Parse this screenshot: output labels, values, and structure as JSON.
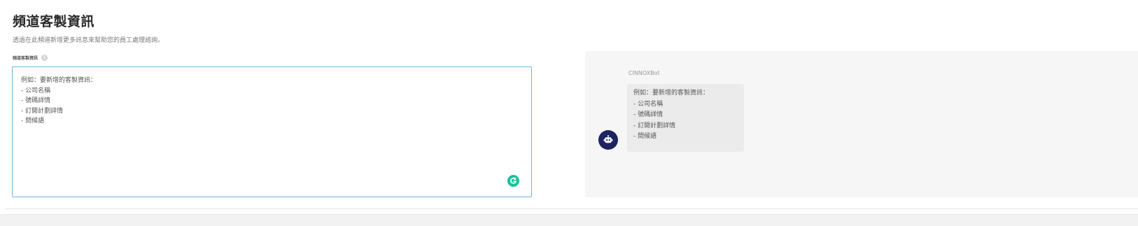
{
  "section": {
    "title": "頻道客製資訊",
    "description": "透過在此頻道新增更多訊息來幫助您的員工處理諮詢。"
  },
  "field": {
    "label": "頻道客製資訊",
    "info_icon": "info-icon",
    "value_lines": [
      "例如：要新增的客製資訊：",
      "- 公司名稱",
      "- 號碼詳情",
      "- 訂閱計劃詳情",
      "- 問候語"
    ],
    "grammarly_icon": "grammarly-icon"
  },
  "preview": {
    "bot_name": "CINNOXBot",
    "bubble_lines": [
      "例如：要新增的客製資訊：",
      "- 公司名稱",
      "- 號碼詳情",
      "- 訂閱計劃詳情",
      "- 問候語"
    ],
    "avatar_icon": "robot-icon"
  },
  "colors": {
    "field_border": "#6fb3e6",
    "avatar_bg": "#1e2460",
    "grammarly": "#15c39a",
    "preview_bg": "#f6f6f6",
    "bubble_bg": "#ebebeb"
  }
}
